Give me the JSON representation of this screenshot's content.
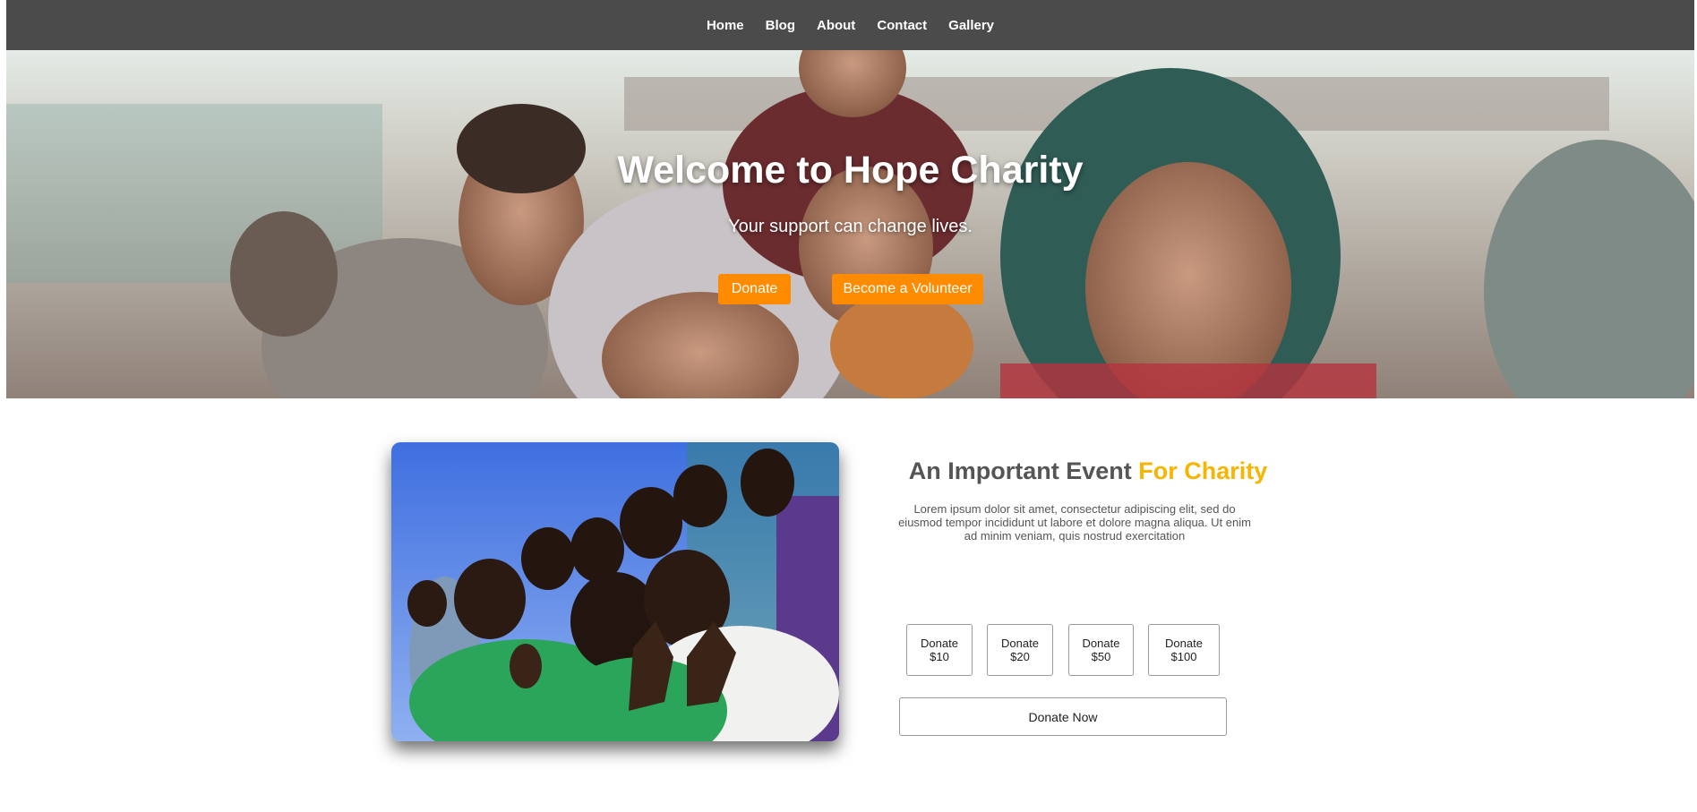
{
  "nav": {
    "items": [
      {
        "label": "Home"
      },
      {
        "label": "Blog"
      },
      {
        "label": "About"
      },
      {
        "label": "Contact"
      },
      {
        "label": "Gallery"
      }
    ]
  },
  "hero": {
    "title": "Welcome to Hope Charity",
    "tagline": "Your support can change lives.",
    "donate_label": "Donate",
    "volunteer_label": "Become a Volunteer",
    "button_color": "#ff8c00"
  },
  "event": {
    "title_main": "An Important Event",
    "title_accent": "For Charity",
    "accent_color": "#f7b500",
    "description": "Lorem ipsum dolor sit amet, consectetur adipiscing elit, sed do eiusmod tempor incididunt ut labore et dolore magna aliqua. Ut enim ad minim veniam, quis nostrud exercitation",
    "amounts": [
      {
        "line1": "Donate",
        "line2": "$10"
      },
      {
        "line1": "Donate",
        "line2": "$20"
      },
      {
        "line1": "Donate",
        "line2": "$50"
      },
      {
        "line1": "Donate",
        "line2": "$100"
      }
    ],
    "donate_now_label": "Donate Now"
  },
  "colors": {
    "nav_background": "#4b4b4b",
    "text_gray": "#555555"
  }
}
